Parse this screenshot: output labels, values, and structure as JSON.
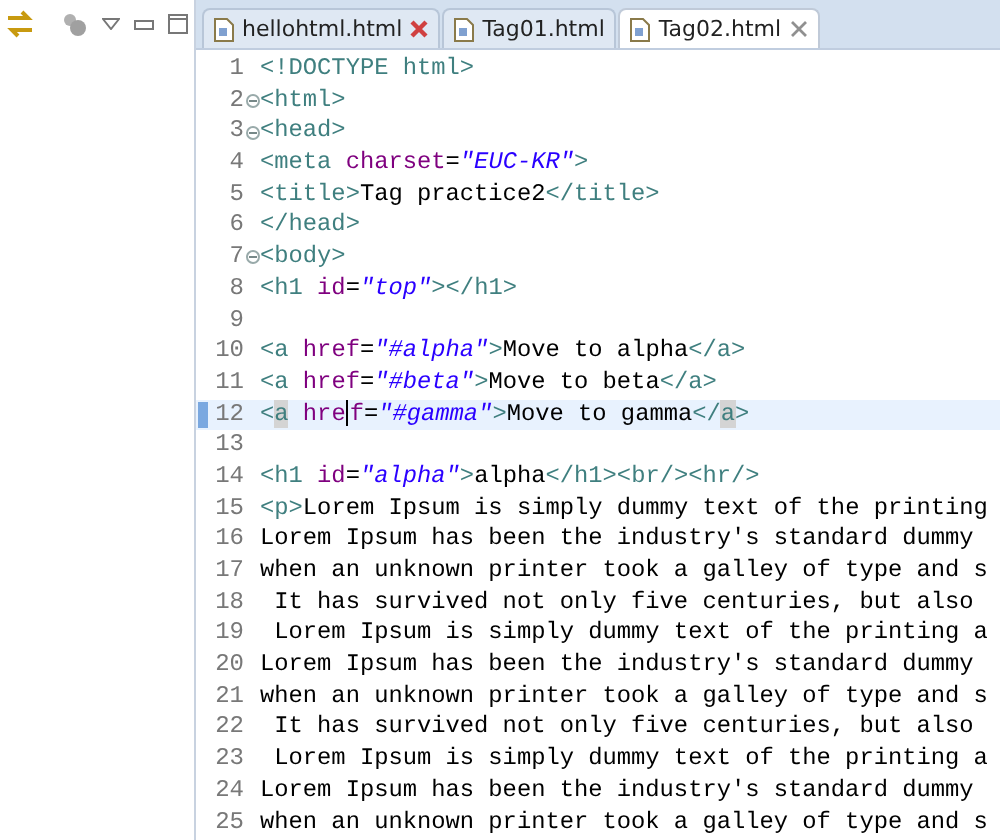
{
  "tabs": [
    {
      "label": "hellohtml.html",
      "selected": false,
      "close_hover": true
    },
    {
      "label": "Tag01.html",
      "selected": false,
      "close_hover": false
    },
    {
      "label": "Tag02.html",
      "selected": true,
      "close_hover": false
    }
  ],
  "editor": {
    "lines": [
      {
        "number": "1",
        "fold": false,
        "current": false,
        "tokens": [
          {
            "kind": "tag",
            "text": "<!DOCTYPE html>"
          }
        ]
      },
      {
        "number": "2",
        "fold": true,
        "current": false,
        "tokens": [
          {
            "kind": "tag",
            "text": "<html>"
          }
        ]
      },
      {
        "number": "3",
        "fold": true,
        "current": false,
        "tokens": [
          {
            "kind": "tag",
            "text": "<head>"
          }
        ]
      },
      {
        "number": "4",
        "fold": false,
        "current": false,
        "tokens": [
          {
            "kind": "tag",
            "text": "<meta "
          },
          {
            "kind": "attr",
            "text": "charset"
          },
          {
            "kind": "text",
            "text": "="
          },
          {
            "kind": "value",
            "text": "\"EUC-KR\""
          },
          {
            "kind": "tag",
            "text": ">"
          }
        ]
      },
      {
        "number": "5",
        "fold": false,
        "current": false,
        "tokens": [
          {
            "kind": "tag",
            "text": "<title>"
          },
          {
            "kind": "text",
            "text": "Tag practice2"
          },
          {
            "kind": "tag",
            "text": "</title>"
          }
        ]
      },
      {
        "number": "6",
        "fold": false,
        "current": false,
        "tokens": [
          {
            "kind": "tag",
            "text": "</head>"
          }
        ]
      },
      {
        "number": "7",
        "fold": true,
        "current": false,
        "tokens": [
          {
            "kind": "tag",
            "text": "<body>"
          }
        ]
      },
      {
        "number": "8",
        "fold": false,
        "current": false,
        "tokens": [
          {
            "kind": "tag",
            "text": "<h1 "
          },
          {
            "kind": "attr",
            "text": "id"
          },
          {
            "kind": "text",
            "text": "="
          },
          {
            "kind": "value",
            "text": "\"top\""
          },
          {
            "kind": "tag",
            "text": "></h1>"
          }
        ]
      },
      {
        "number": "9",
        "fold": false,
        "current": false
      },
      {
        "number": "10",
        "fold": false,
        "current": false,
        "tokens": [
          {
            "kind": "tag",
            "text": "<a "
          },
          {
            "kind": "attr",
            "text": "href"
          },
          {
            "kind": "text",
            "text": "="
          },
          {
            "kind": "value",
            "text": "\"#alpha\""
          },
          {
            "kind": "tag",
            "text": ">"
          },
          {
            "kind": "text",
            "text": "Move to alpha"
          },
          {
            "kind": "tag",
            "text": "</a>"
          }
        ]
      },
      {
        "number": "11",
        "fold": false,
        "current": false,
        "tokens": [
          {
            "kind": "tag",
            "text": "<a "
          },
          {
            "kind": "attr",
            "text": "href"
          },
          {
            "kind": "text",
            "text": "="
          },
          {
            "kind": "value",
            "text": "\"#beta\""
          },
          {
            "kind": "tag",
            "text": ">"
          },
          {
            "kind": "text",
            "text": "Move to beta"
          },
          {
            "kind": "tag",
            "text": "</a>"
          }
        ]
      },
      {
        "number": "12",
        "fold": false,
        "current": true,
        "tokens": [
          {
            "kind": "tag",
            "text": "<"
          },
          {
            "kind": "tag",
            "text": "a",
            "match": true
          },
          {
            "kind": "attr",
            "text": " hre"
          },
          {
            "kind": "caret"
          },
          {
            "kind": "attr",
            "text": "f"
          },
          {
            "kind": "text",
            "text": "="
          },
          {
            "kind": "value",
            "text": "\"#gamma\""
          },
          {
            "kind": "tag",
            "text": ">"
          },
          {
            "kind": "text",
            "text": "Move to gamma"
          },
          {
            "kind": "tag",
            "text": "</"
          },
          {
            "kind": "tag",
            "text": "a",
            "match": true
          },
          {
            "kind": "tag",
            "text": ">"
          }
        ]
      },
      {
        "number": "13",
        "fold": false,
        "current": false
      },
      {
        "number": "14",
        "fold": false,
        "current": false,
        "tokens": [
          {
            "kind": "tag",
            "text": "<h1 "
          },
          {
            "kind": "attr",
            "text": "id"
          },
          {
            "kind": "text",
            "text": "="
          },
          {
            "kind": "value",
            "text": "\"alpha\""
          },
          {
            "kind": "tag",
            "text": ">"
          },
          {
            "kind": "text",
            "text": "alpha"
          },
          {
            "kind": "tag",
            "text": "</h1><br/><hr/>"
          }
        ]
      },
      {
        "number": "15",
        "fold": false,
        "current": false,
        "tokens": [
          {
            "kind": "tag",
            "text": "<p>"
          },
          {
            "kind": "text",
            "text": "Lorem Ipsum is simply dummy text of the printing"
          }
        ]
      },
      {
        "number": "16",
        "fold": false,
        "current": false,
        "tokens": [
          {
            "kind": "text",
            "text": "Lorem Ipsum has been the industry's standard dummy"
          }
        ]
      },
      {
        "number": "17",
        "fold": false,
        "current": false,
        "tokens": [
          {
            "kind": "text",
            "text": "when an unknown printer took a galley of type and s"
          }
        ]
      },
      {
        "number": "18",
        "fold": false,
        "current": false,
        "tokens": [
          {
            "kind": "text",
            "text": " It has survived not only five centuries, but also"
          }
        ]
      },
      {
        "number": "19",
        "fold": false,
        "current": false,
        "tokens": [
          {
            "kind": "text",
            "text": " Lorem Ipsum is simply dummy text of the printing a"
          }
        ]
      },
      {
        "number": "20",
        "fold": false,
        "current": false,
        "tokens": [
          {
            "kind": "text",
            "text": "Lorem Ipsum has been the industry's standard dummy"
          }
        ]
      },
      {
        "number": "21",
        "fold": false,
        "current": false,
        "tokens": [
          {
            "kind": "text",
            "text": "when an unknown printer took a galley of type and s"
          }
        ]
      },
      {
        "number": "22",
        "fold": false,
        "current": false,
        "tokens": [
          {
            "kind": "text",
            "text": " It has survived not only five centuries, but also"
          }
        ]
      },
      {
        "number": "23",
        "fold": false,
        "current": false,
        "tokens": [
          {
            "kind": "text",
            "text": " Lorem Ipsum is simply dummy text of the printing a"
          }
        ]
      },
      {
        "number": "24",
        "fold": false,
        "current": false,
        "tokens": [
          {
            "kind": "text",
            "text": "Lorem Ipsum has been the industry's standard dummy"
          }
        ]
      },
      {
        "number": "25",
        "fold": false,
        "current": false,
        "tokens": [
          {
            "kind": "text",
            "text": "when an unknown printer took a galley of type and s"
          }
        ]
      }
    ]
  }
}
